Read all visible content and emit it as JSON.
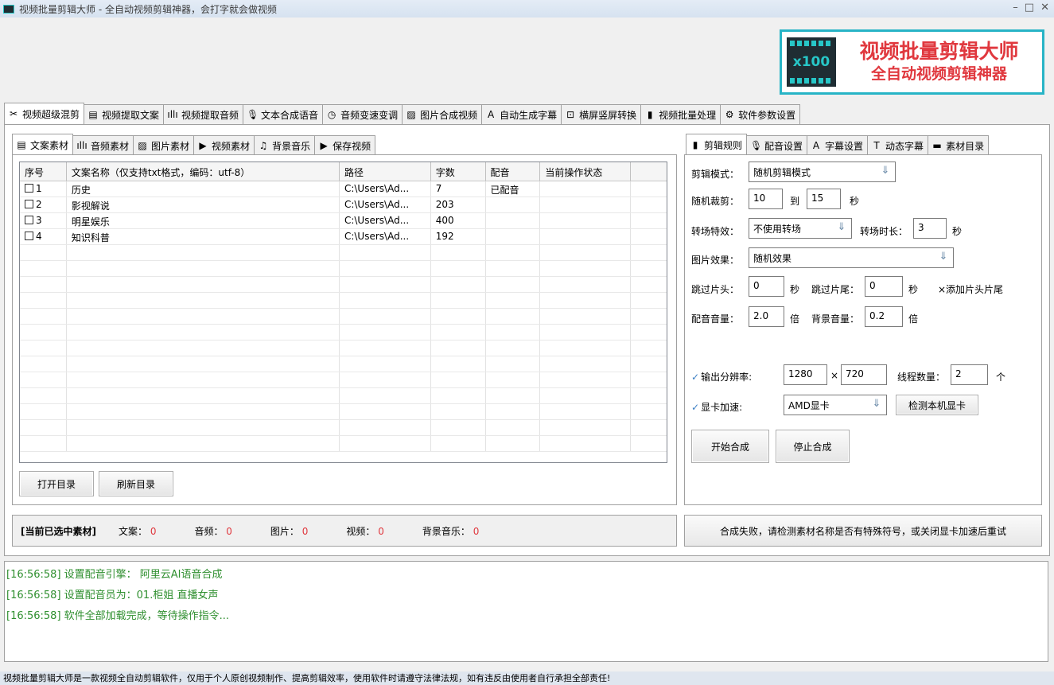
{
  "window": {
    "title": "视频批量剪辑大师 - 全自动视频剪辑神器，会打字就会做视频",
    "controls": [
      "–",
      "□",
      "✕"
    ]
  },
  "banner": {
    "badge": "x100",
    "line1": "视频批量剪辑大师",
    "line2": "全自动视频剪辑神器"
  },
  "main_tabs": [
    {
      "label": "视频超级混剪",
      "icon": "scissors-icon",
      "glyph": "✂"
    },
    {
      "label": "视频提取文案",
      "icon": "document-icon",
      "glyph": "▤"
    },
    {
      "label": "视频提取音频",
      "icon": "audio-wave-icon",
      "glyph": "ıllı"
    },
    {
      "label": "文本合成语音",
      "icon": "microphone-icon",
      "glyph": "🎙"
    },
    {
      "label": "音频变速变调",
      "icon": "speedometer-icon",
      "glyph": "◷"
    },
    {
      "label": "图片合成视频",
      "icon": "image-icon",
      "glyph": "▨"
    },
    {
      "label": "自动生成字幕",
      "icon": "font-icon",
      "glyph": "A"
    },
    {
      "label": "横屏竖屏转换",
      "icon": "rotate-screen-icon",
      "glyph": "⊡"
    },
    {
      "label": "视频批量处理",
      "icon": "film-icon",
      "glyph": "▮"
    },
    {
      "label": "软件参数设置",
      "icon": "gear-icon",
      "glyph": "⚙"
    }
  ],
  "left_tabs": [
    {
      "label": "文案素材",
      "icon": "document-icon",
      "glyph": "▤"
    },
    {
      "label": "音频素材",
      "icon": "audio-wave-icon",
      "glyph": "ıllı"
    },
    {
      "label": "图片素材",
      "icon": "image-icon",
      "glyph": "▨"
    },
    {
      "label": "视频素材",
      "icon": "play-icon",
      "glyph": "▶"
    },
    {
      "label": "背景音乐",
      "icon": "music-icon",
      "glyph": "♫"
    },
    {
      "label": "保存视频",
      "icon": "save-video-icon",
      "glyph": "▶"
    }
  ],
  "table": {
    "headers": [
      "序号",
      "文案名称（仅支持txt格式，编码：utf-8）",
      "路径",
      "字数",
      "配音",
      "当前操作状态",
      ""
    ],
    "rows": [
      {
        "no": "1",
        "name": "历史",
        "path": "C:\\Users\\Ad...",
        "count": "7",
        "dub": "已配音",
        "status": ""
      },
      {
        "no": "2",
        "name": "影视解说",
        "path": "C:\\Users\\Ad...",
        "count": "203",
        "dub": "",
        "status": ""
      },
      {
        "no": "3",
        "name": "明星娱乐",
        "path": "C:\\Users\\Ad...",
        "count": "400",
        "dub": "",
        "status": ""
      },
      {
        "no": "4",
        "name": "知识科普",
        "path": "C:\\Users\\Ad...",
        "count": "192",
        "dub": "",
        "status": ""
      }
    ]
  },
  "buttons": {
    "open_dir": "打开目录",
    "refresh_dir": "刷新目录",
    "start": "开始合成",
    "stop": "停止合成",
    "detect_gpu": "检测本机显卡"
  },
  "selected_status": {
    "label": "[当前已选中素材]",
    "items": [
      {
        "name": "文案：",
        "value": "0"
      },
      {
        "name": "音频：",
        "value": "0"
      },
      {
        "name": "图片：",
        "value": "0"
      },
      {
        "name": "视频：",
        "value": "0"
      },
      {
        "name": "背景音乐：",
        "value": "0"
      }
    ]
  },
  "right_tabs": [
    {
      "label": "剪辑规则",
      "icon": "film-icon",
      "glyph": "▮"
    },
    {
      "label": "配音设置",
      "icon": "microphone-icon",
      "glyph": "🎙"
    },
    {
      "label": "字幕设置",
      "icon": "font-icon",
      "glyph": "A"
    },
    {
      "label": "动态字幕",
      "icon": "text-box-icon",
      "glyph": "T"
    },
    {
      "label": "素材目录",
      "icon": "folder-icon",
      "glyph": "▬"
    }
  ],
  "settings": {
    "edit_mode_label": "剪辑模式：",
    "edit_mode": "随机剪辑模式",
    "random_cut_label": "随机裁剪：",
    "random_from": "10",
    "to": "到",
    "random_to": "15",
    "sec": "秒",
    "transition_label": "转场特效：",
    "transition": "不使用转场",
    "transition_dur_label": "转场时长：",
    "transition_dur": "3",
    "image_effect_label": "图片效果：",
    "image_effect": "随机效果",
    "skip_head_label": "跳过片头：",
    "skip_head": "0",
    "skip_tail_label": "跳过片尾：",
    "skip_tail": "0",
    "add_head_tail": "×添加片头片尾",
    "dub_volume_label": "配音音量：",
    "dub_volume": "2.0",
    "times": "倍",
    "bg_volume_label": "背景音量：",
    "bg_volume": "0.2",
    "resolution_label": "输出分辨率:",
    "res_w": "1280",
    "res_x": "×",
    "res_h": "720",
    "threads_label": "线程数量：",
    "threads": "2",
    "threads_unit": "个",
    "gpu_label": "显卡加速:",
    "gpu": "AMD显卡"
  },
  "error_message": "合成失败，请检测素材名称是否有特殊符号，或关闭显卡加速后重试",
  "log": [
    "[16:56:58] 设置配音引擎： 阿里云AI语音合成",
    "[16:56:58] 设置配音员为：01.柜姐 直播女声",
    "[16:56:58] 软件全部加载完成，等待操作指令..."
  ],
  "footer": "视频批量剪辑大师是一款视频全自动剪辑软件，仅用于个人原创视频制作、提高剪辑效率，使用软件时请遵守法律法规，如有违反由使用者自行承担全部责任!",
  "colors": {
    "accent": "#27b4c6",
    "brand_red": "#e0383e",
    "log_green": "#2f8f2f",
    "count_red": "#e0383e"
  }
}
